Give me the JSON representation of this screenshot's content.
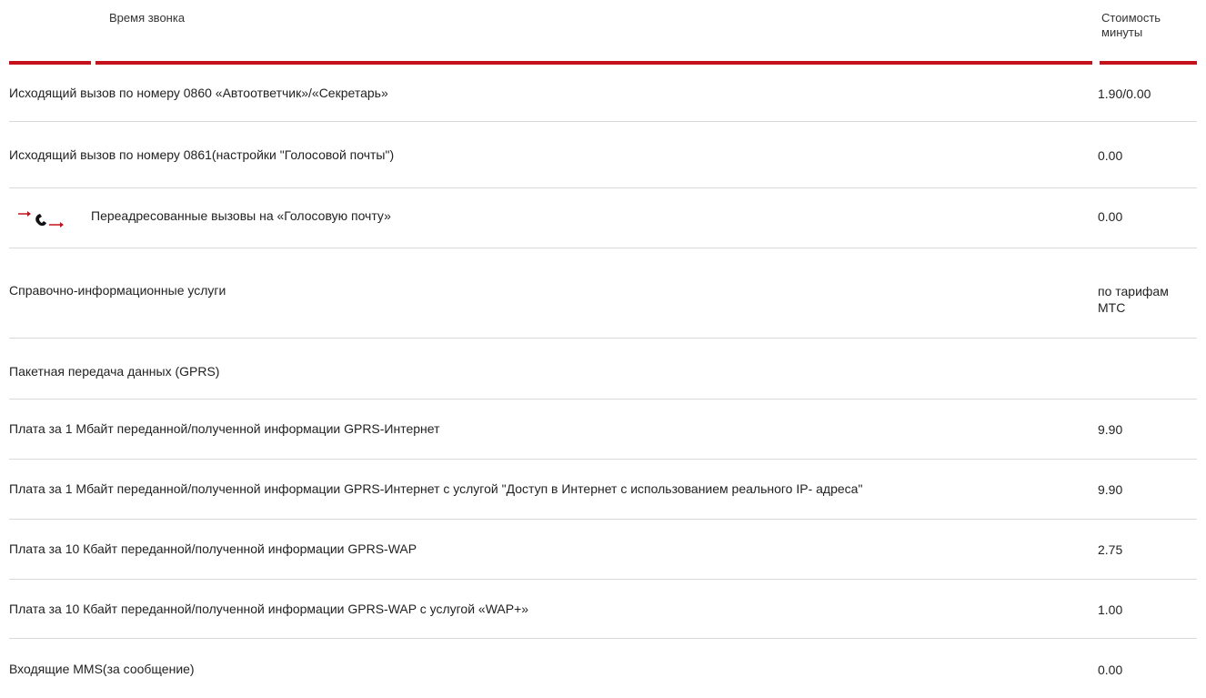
{
  "header": {
    "time_label": "Время звонка",
    "cost_label_line1": "Стоимость",
    "cost_label_line2": "минуты"
  },
  "colors": {
    "accent": "#c4121c",
    "divider": "#d9d9d9"
  },
  "rows": [
    {
      "label": "Исходящий вызов по номеру 0860 «Автоответчик»/«Секретарь»",
      "value": "1.90/0.00"
    },
    {
      "label": "Исходящий вызов по номеру 0861(настройки \"Голосовой почты\")",
      "value": "0.00"
    },
    {
      "label": "Переадресованные вызовы на «Голосовую почту»",
      "value": "0.00",
      "icon": "call-forward-icon"
    },
    {
      "label": "Справочно-информационные услуги",
      "value_line1": "по тарифам",
      "value_line2": "МТС"
    },
    {
      "label": "Пакетная передача данных (GPRS)",
      "value": ""
    },
    {
      "label": "Плата за 1 Мбайт переданной/полученной информации GPRS-Интернет",
      "value": "9.90"
    },
    {
      "label": "Плата за 1 Мбайт переданной/полученной информации GPRS-Интернет с услугой \"Доступ в Интернет с использованием реального IP- адреса\"",
      "value": "9.90"
    },
    {
      "label": "Плата за 10 Кбайт переданной/полученной информации GPRS-WAP",
      "value": "2.75"
    },
    {
      "label": "Плата за 10 Кбайт переданной/полученной информации GPRS-WAP с услугой «WAP+»",
      "value": "1.00"
    },
    {
      "label": "Входящие MMS(за сообщение)",
      "value": "0.00"
    }
  ]
}
